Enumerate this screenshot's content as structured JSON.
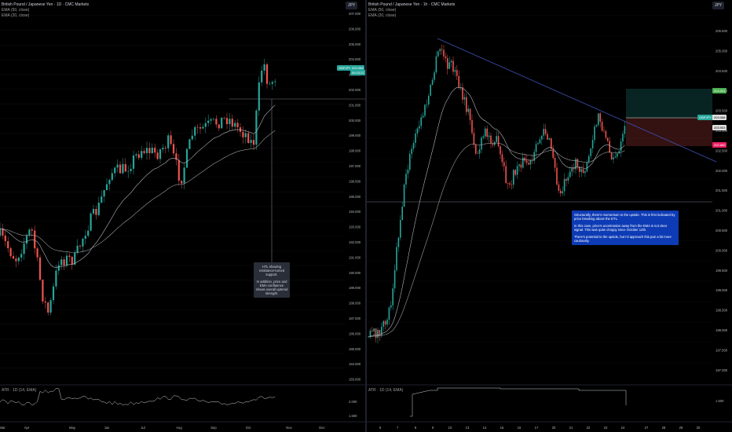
{
  "colors": {
    "up": "#26a69a",
    "down": "#ef5350",
    "ema50": "#9e9e9e",
    "ema20": "#b2b5be",
    "trend": "#3f51b5",
    "grid": "#0d0d0d",
    "atr": "#d1d4dc",
    "line": "#787b86"
  },
  "left": {
    "title": "British Pound / Japanese Yen · 1D · CMC Markets",
    "ema1": "EMA (50, close)",
    "ema2": "EMA (20, close)",
    "symbol": "JPY",
    "price_tag_symbol": "GBPJPY",
    "price_tag_value": "203.068",
    "price_tag_time": "09:23:22",
    "annotation": [
      "HTL showing resistance-turned support.",
      "In addition, price and EMA confluence shows overall uptrend strength."
    ],
    "atr_label": "ATR · 1D (14, EMA)",
    "atr_axis": [
      "2.000",
      "1.500"
    ],
    "x_labels": [
      "Mar",
      "Apr",
      "May",
      "Jun",
      "Jul",
      "Aug",
      "Sep",
      "Oct",
      "Nov",
      "Dec"
    ],
    "y_labels": [
      "207.000",
      "206.000",
      "205.000",
      "204.000",
      "203.000",
      "202.000",
      "201.000",
      "200.000",
      "199.000",
      "198.000",
      "197.000",
      "196.000",
      "195.000",
      "194.000",
      "193.000",
      "192.000",
      "191.000",
      "190.000",
      "189.000",
      "188.000",
      "187.000",
      "186.000",
      "185.000",
      "184.000",
      "183.000"
    ]
  },
  "right": {
    "title": "British Pound / Japanese Yen · 1h · CMC Markets",
    "ema1": "EMA (50, close)",
    "ema2": "EMA (20, close)",
    "symbol": "JPY",
    "price_tag_symbol": "GBPJPY",
    "price_tag_value": "203.068",
    "price_tag_time": "203.903",
    "target_tag": "204.001",
    "stop_tag": "202.660",
    "annotation": [
      "Structurally, there's momentum to the upside. This is first indicated by price breaking above the DTL.",
      "In this case, price's acceleration away from the EMA is not clear signal. This was quite choppy since October 12th.",
      "There's potential to the upside, but I'd approach this pair a bit more cautiously."
    ],
    "atr_label": "ATR · 1D (14, EMA)",
    "atr_axis": [
      "1.500"
    ],
    "x_labels": [
      "6",
      "7",
      "8",
      "9",
      "10",
      "13",
      "14",
      "15",
      "16",
      "17",
      "20",
      "21",
      "22",
      "23",
      "24",
      "27",
      "28",
      "29",
      "30"
    ],
    "y_labels": [
      "205.500",
      "205.000",
      "204.500",
      "204.000",
      "203.500",
      "203.000",
      "202.500",
      "202.000",
      "201.500",
      "201.000",
      "200.500",
      "200.000",
      "199.500",
      "199.000",
      "198.500",
      "198.000",
      "197.500",
      "197.000"
    ]
  }
}
